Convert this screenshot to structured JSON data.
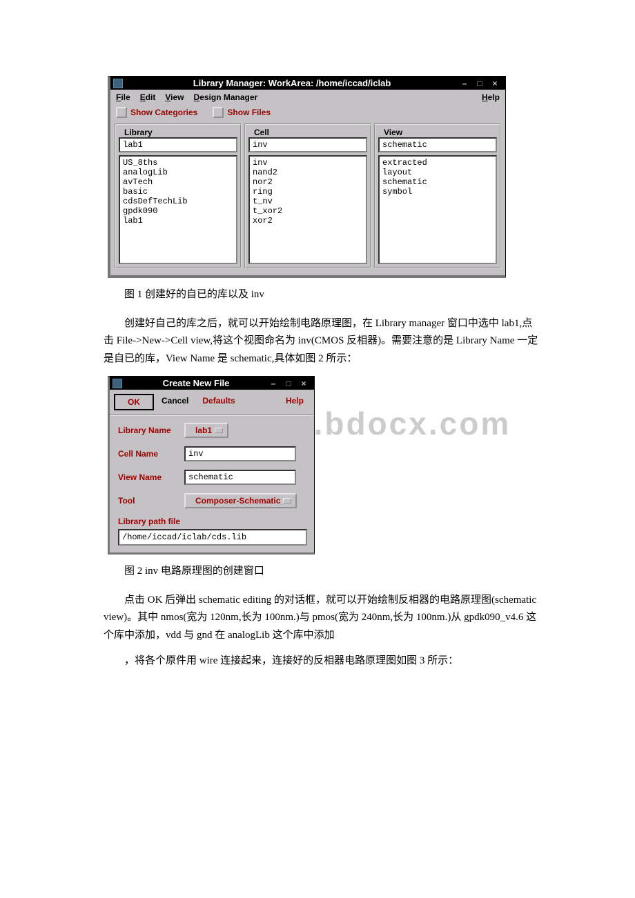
{
  "libmgr": {
    "title": "Library Manager: WorkArea: /home/iccad/iclab",
    "menu": {
      "file": "File",
      "edit": "Edit",
      "view": "View",
      "designManager": "Design Manager",
      "help": "Help"
    },
    "toggles": {
      "showCategories": "Show Categories",
      "showFiles": "Show Files"
    },
    "columns": {
      "library": {
        "header": "Library",
        "selected": "lab1",
        "items": [
          "US_8ths",
          "analogLib",
          "avTech",
          "basic",
          "cdsDefTechLib",
          "gpdk090",
          "lab1"
        ]
      },
      "cell": {
        "header": "Cell",
        "selected": "inv",
        "items": [
          "inv",
          "nand2",
          "nor2",
          "ring",
          "t_nv",
          "t_xor2",
          "xor2"
        ]
      },
      "view": {
        "header": "View",
        "selected": "schematic",
        "items": [
          "extracted",
          "layout",
          "schematic",
          "symbol"
        ]
      }
    }
  },
  "caption1": "图 1 创建好的自已的库以及 inv",
  "para1": "创建好自己的库之后，就可以开始绘制电路原理图，在 Library manager 窗口中选中 lab1,点击 File->New->Cell view,将这个视图命名为 inv(CMOS 反相器)。需要注意的是 Library Name 一定是自已的库，View Name 是 schematic,具体如图 2 所示：",
  "watermark": "www.bdocx.com",
  "cnf": {
    "title": "Create New File",
    "buttons": {
      "ok": "OK",
      "cancel": "Cancel",
      "defaults": "Defaults",
      "help": "Help"
    },
    "labels": {
      "libraryName": "Library Name",
      "cellName": "Cell Name",
      "viewName": "View Name",
      "tool": "Tool",
      "libraryPathFile": "Library path file"
    },
    "values": {
      "libraryName": "lab1",
      "cellName": "inv",
      "viewName": "schematic",
      "tool": "Composer-Schematic",
      "libraryPathFile": "/home/iccad/iclab/cds.lib"
    }
  },
  "caption2": "图 2 inv 电路原理图的创建窗口",
  "para2": "点击 OK 后弹出 schematic editing 的对话框，就可以开始绘制反相器的电路原理图(schematic view)。其中 nmos(宽为 120nm,长为 100nm.)与 pmos(宽为 240nm,长为 100nm.)从 gpdk090_v4.6 这个库中添加，vdd 与 gnd 在 analogLib 这个库中添加",
  "para3": "，将各个原件用 wire 连接起来，连接好的反相器电路原理图如图 3 所示："
}
